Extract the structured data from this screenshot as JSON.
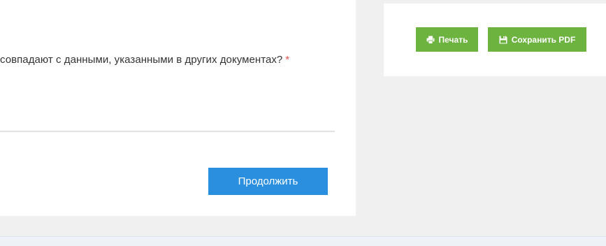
{
  "main": {
    "question_text": "совпадают с данными, указанными в других документах?",
    "required_marker": "*",
    "continue_label": "Продолжить"
  },
  "sidebar": {
    "print_label": "Печать",
    "print_icon": "printer-icon",
    "save_pdf_label": "Сохранить PDF",
    "save_pdf_icon": "save-icon"
  },
  "colors": {
    "primary_button": "#2a8fde",
    "green_button": "#6db33f",
    "required": "#d9534f",
    "background": "#f0f0f0"
  }
}
